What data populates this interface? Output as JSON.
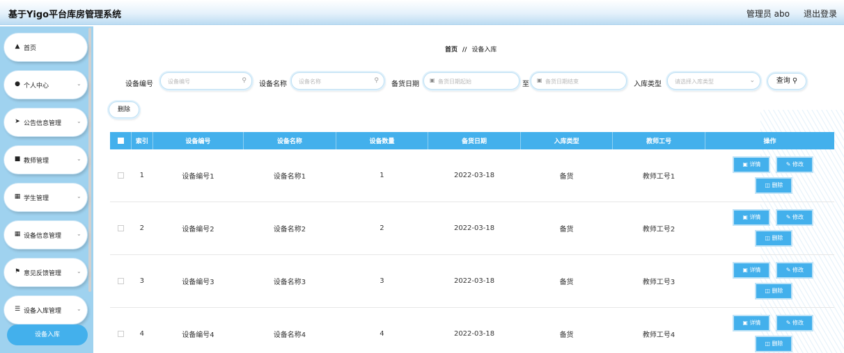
{
  "header": {
    "title": "基于Yigo平台库房管理系统",
    "user": "管理员 abo",
    "logout": "退出登录"
  },
  "sidebar": {
    "items": [
      {
        "label": "首页",
        "icon": "home-icon"
      },
      {
        "label": "个人中心",
        "icon": "user-icon"
      },
      {
        "label": "公告信息管理",
        "icon": "send-icon"
      },
      {
        "label": "教师管理",
        "icon": "chat-icon"
      },
      {
        "label": "学生管理",
        "icon": "grid-icon"
      },
      {
        "label": "设备信息管理",
        "icon": "grid-icon"
      },
      {
        "label": "意见反馈管理",
        "icon": "flag-icon"
      },
      {
        "label": "设备入库管理",
        "icon": "list-icon"
      }
    ],
    "active": "设备入库"
  },
  "breadcrumb": {
    "home": "首页",
    "sep": "//",
    "current": "设备入库"
  },
  "filters": {
    "code_label": "设备编号",
    "code_placeholder": "设备编号",
    "name_label": "设备名称",
    "name_placeholder": "设备名称",
    "date_label": "备货日期",
    "date_start_placeholder": "备货日期起始",
    "date_to": "至",
    "date_end_placeholder": "备货日期结束",
    "type_label": "入库类型",
    "type_placeholder": "请选择入库类型",
    "query_button": "查询"
  },
  "toolbar": {
    "delete_button": "删除"
  },
  "table": {
    "columns": [
      "索引",
      "设备编号",
      "设备名称",
      "设备数量",
      "备货日期",
      "入库类型",
      "教师工号",
      "操作"
    ],
    "rows": [
      {
        "index": "1",
        "code": "设备编号1",
        "name": "设备名称1",
        "qty": "1",
        "date": "2022-03-18",
        "type": "备货",
        "teacher": "教师工号1"
      },
      {
        "index": "2",
        "code": "设备编号2",
        "name": "设备名称2",
        "qty": "2",
        "date": "2022-03-18",
        "type": "备货",
        "teacher": "教师工号2"
      },
      {
        "index": "3",
        "code": "设备编号3",
        "name": "设备名称3",
        "qty": "3",
        "date": "2022-03-18",
        "type": "备货",
        "teacher": "教师工号3"
      },
      {
        "index": "4",
        "code": "设备编号4",
        "name": "设备名称4",
        "qty": "4",
        "date": "2022-03-18",
        "type": "备货",
        "teacher": "教师工号4"
      }
    ],
    "actions": {
      "detail": "详情",
      "edit": "修改",
      "delete": "删除"
    }
  },
  "colors": {
    "accent": "#43b0ec",
    "sidebar_bg": "#9fd2ef"
  }
}
